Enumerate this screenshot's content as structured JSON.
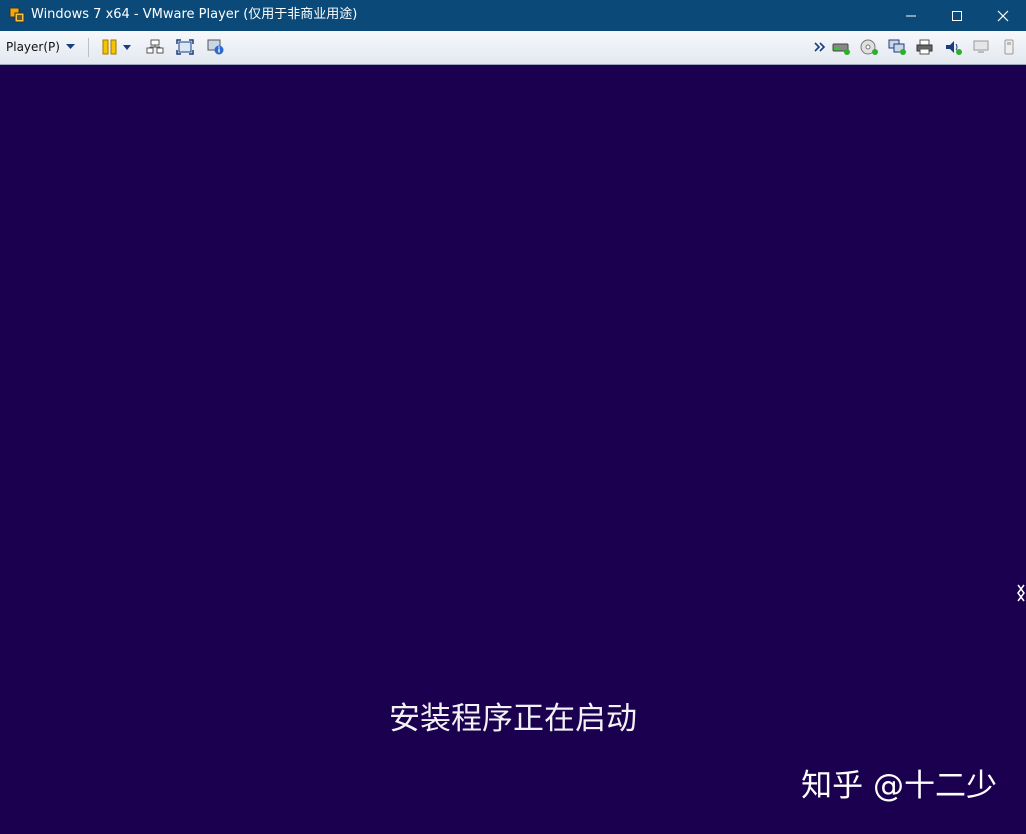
{
  "window": {
    "title": "Windows 7 x64 - VMware Player (仅用于非商业用途)",
    "controls": [
      "minimize-icon",
      "maximize-icon",
      "close-icon"
    ],
    "colors": {
      "titlebar": "#0b4a78",
      "vm_background": "#1b0050"
    }
  },
  "toolbar": {
    "player_menu_label": "Player(P)",
    "left_icons": [
      "pause-icon",
      "dropdown-arrow-icon",
      "send-ctrl-alt-del-icon",
      "fullscreen-icon",
      "unity-icon"
    ],
    "device_icons": [
      "more-devices-icon",
      "hard-disk-icon",
      "cd-dvd-icon",
      "network-adapter-icon",
      "printer-icon",
      "sound-card-icon",
      "display-icon",
      "usb-device-icon"
    ]
  },
  "vm": {
    "status_text": "安装程序正在启动",
    "watermark": "知乎 @十二少"
  }
}
